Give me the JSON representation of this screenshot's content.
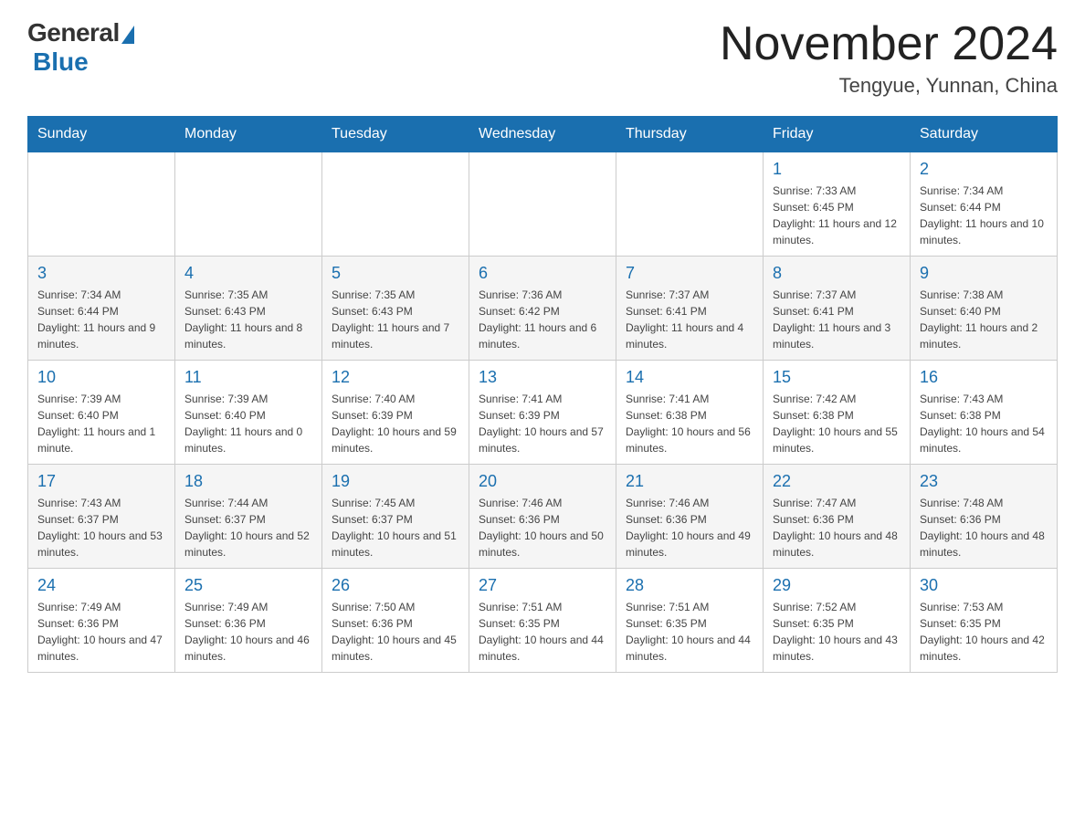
{
  "header": {
    "logo_general": "General",
    "logo_blue": "Blue",
    "month_title": "November 2024",
    "location": "Tengyue, Yunnan, China"
  },
  "days_of_week": [
    "Sunday",
    "Monday",
    "Tuesday",
    "Wednesday",
    "Thursday",
    "Friday",
    "Saturday"
  ],
  "weeks": [
    [
      {
        "day": "",
        "info": ""
      },
      {
        "day": "",
        "info": ""
      },
      {
        "day": "",
        "info": ""
      },
      {
        "day": "",
        "info": ""
      },
      {
        "day": "",
        "info": ""
      },
      {
        "day": "1",
        "info": "Sunrise: 7:33 AM\nSunset: 6:45 PM\nDaylight: 11 hours and 12 minutes."
      },
      {
        "day": "2",
        "info": "Sunrise: 7:34 AM\nSunset: 6:44 PM\nDaylight: 11 hours and 10 minutes."
      }
    ],
    [
      {
        "day": "3",
        "info": "Sunrise: 7:34 AM\nSunset: 6:44 PM\nDaylight: 11 hours and 9 minutes."
      },
      {
        "day": "4",
        "info": "Sunrise: 7:35 AM\nSunset: 6:43 PM\nDaylight: 11 hours and 8 minutes."
      },
      {
        "day": "5",
        "info": "Sunrise: 7:35 AM\nSunset: 6:43 PM\nDaylight: 11 hours and 7 minutes."
      },
      {
        "day": "6",
        "info": "Sunrise: 7:36 AM\nSunset: 6:42 PM\nDaylight: 11 hours and 6 minutes."
      },
      {
        "day": "7",
        "info": "Sunrise: 7:37 AM\nSunset: 6:41 PM\nDaylight: 11 hours and 4 minutes."
      },
      {
        "day": "8",
        "info": "Sunrise: 7:37 AM\nSunset: 6:41 PM\nDaylight: 11 hours and 3 minutes."
      },
      {
        "day": "9",
        "info": "Sunrise: 7:38 AM\nSunset: 6:40 PM\nDaylight: 11 hours and 2 minutes."
      }
    ],
    [
      {
        "day": "10",
        "info": "Sunrise: 7:39 AM\nSunset: 6:40 PM\nDaylight: 11 hours and 1 minute."
      },
      {
        "day": "11",
        "info": "Sunrise: 7:39 AM\nSunset: 6:40 PM\nDaylight: 11 hours and 0 minutes."
      },
      {
        "day": "12",
        "info": "Sunrise: 7:40 AM\nSunset: 6:39 PM\nDaylight: 10 hours and 59 minutes."
      },
      {
        "day": "13",
        "info": "Sunrise: 7:41 AM\nSunset: 6:39 PM\nDaylight: 10 hours and 57 minutes."
      },
      {
        "day": "14",
        "info": "Sunrise: 7:41 AM\nSunset: 6:38 PM\nDaylight: 10 hours and 56 minutes."
      },
      {
        "day": "15",
        "info": "Sunrise: 7:42 AM\nSunset: 6:38 PM\nDaylight: 10 hours and 55 minutes."
      },
      {
        "day": "16",
        "info": "Sunrise: 7:43 AM\nSunset: 6:38 PM\nDaylight: 10 hours and 54 minutes."
      }
    ],
    [
      {
        "day": "17",
        "info": "Sunrise: 7:43 AM\nSunset: 6:37 PM\nDaylight: 10 hours and 53 minutes."
      },
      {
        "day": "18",
        "info": "Sunrise: 7:44 AM\nSunset: 6:37 PM\nDaylight: 10 hours and 52 minutes."
      },
      {
        "day": "19",
        "info": "Sunrise: 7:45 AM\nSunset: 6:37 PM\nDaylight: 10 hours and 51 minutes."
      },
      {
        "day": "20",
        "info": "Sunrise: 7:46 AM\nSunset: 6:36 PM\nDaylight: 10 hours and 50 minutes."
      },
      {
        "day": "21",
        "info": "Sunrise: 7:46 AM\nSunset: 6:36 PM\nDaylight: 10 hours and 49 minutes."
      },
      {
        "day": "22",
        "info": "Sunrise: 7:47 AM\nSunset: 6:36 PM\nDaylight: 10 hours and 48 minutes."
      },
      {
        "day": "23",
        "info": "Sunrise: 7:48 AM\nSunset: 6:36 PM\nDaylight: 10 hours and 48 minutes."
      }
    ],
    [
      {
        "day": "24",
        "info": "Sunrise: 7:49 AM\nSunset: 6:36 PM\nDaylight: 10 hours and 47 minutes."
      },
      {
        "day": "25",
        "info": "Sunrise: 7:49 AM\nSunset: 6:36 PM\nDaylight: 10 hours and 46 minutes."
      },
      {
        "day": "26",
        "info": "Sunrise: 7:50 AM\nSunset: 6:36 PM\nDaylight: 10 hours and 45 minutes."
      },
      {
        "day": "27",
        "info": "Sunrise: 7:51 AM\nSunset: 6:35 PM\nDaylight: 10 hours and 44 minutes."
      },
      {
        "day": "28",
        "info": "Sunrise: 7:51 AM\nSunset: 6:35 PM\nDaylight: 10 hours and 44 minutes."
      },
      {
        "day": "29",
        "info": "Sunrise: 7:52 AM\nSunset: 6:35 PM\nDaylight: 10 hours and 43 minutes."
      },
      {
        "day": "30",
        "info": "Sunrise: 7:53 AM\nSunset: 6:35 PM\nDaylight: 10 hours and 42 minutes."
      }
    ]
  ]
}
